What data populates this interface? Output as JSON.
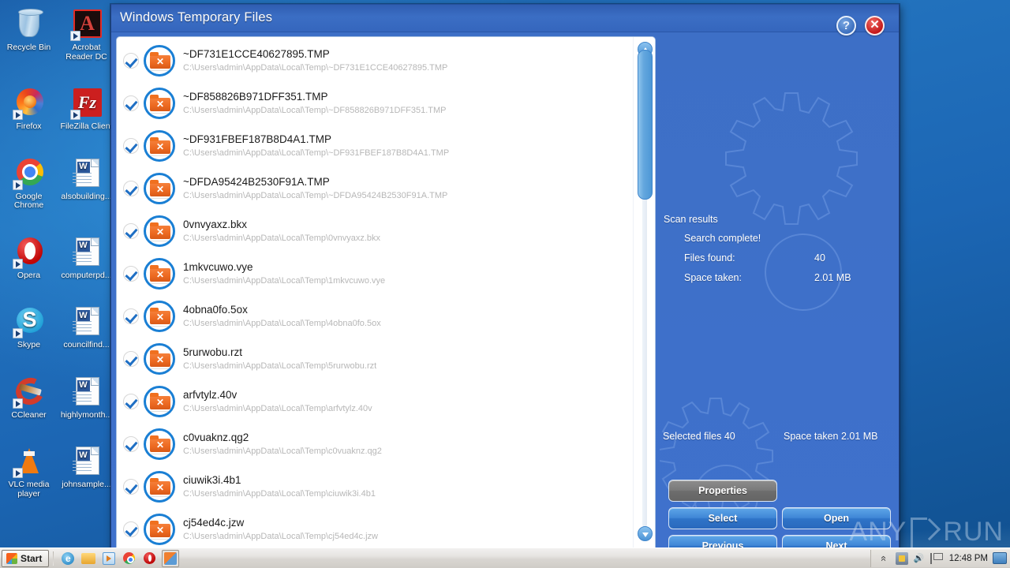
{
  "window": {
    "title": "Windows Temporary Files",
    "help_label": "?",
    "close_label": "✕"
  },
  "files": [
    {
      "name": "~DF731E1CCE40627895.TMP",
      "path": "C:\\Users\\admin\\AppData\\Local\\Temp\\~DF731E1CCE40627895.TMP",
      "checked": true
    },
    {
      "name": "~DF858826B971DFF351.TMP",
      "path": "C:\\Users\\admin\\AppData\\Local\\Temp\\~DF858826B971DFF351.TMP",
      "checked": true
    },
    {
      "name": "~DF931FBEF187B8D4A1.TMP",
      "path": "C:\\Users\\admin\\AppData\\Local\\Temp\\~DF931FBEF187B8D4A1.TMP",
      "checked": true
    },
    {
      "name": "~DFDA95424B2530F91A.TMP",
      "path": "C:\\Users\\admin\\AppData\\Local\\Temp\\~DFDA95424B2530F91A.TMP",
      "checked": true
    },
    {
      "name": "0vnvyaxz.bkx",
      "path": "C:\\Users\\admin\\AppData\\Local\\Temp\\0vnvyaxz.bkx",
      "checked": true
    },
    {
      "name": "1mkvcuwo.vye",
      "path": "C:\\Users\\admin\\AppData\\Local\\Temp\\1mkvcuwo.vye",
      "checked": true
    },
    {
      "name": "4obna0fo.5ox",
      "path": "C:\\Users\\admin\\AppData\\Local\\Temp\\4obna0fo.5ox",
      "checked": true
    },
    {
      "name": "5rurwobu.rzt",
      "path": "C:\\Users\\admin\\AppData\\Local\\Temp\\5rurwobu.rzt",
      "checked": true
    },
    {
      "name": "arfvtylz.40v",
      "path": "C:\\Users\\admin\\AppData\\Local\\Temp\\arfvtylz.40v",
      "checked": true
    },
    {
      "name": "c0vuaknz.qg2",
      "path": "C:\\Users\\admin\\AppData\\Local\\Temp\\c0vuaknz.qg2",
      "checked": true
    },
    {
      "name": "ciuwik3i.4b1",
      "path": "C:\\Users\\admin\\AppData\\Local\\Temp\\ciuwik3i.4b1",
      "checked": true
    },
    {
      "name": "cj54ed4c.jzw",
      "path": "C:\\Users\\admin\\AppData\\Local\\Temp\\cj54ed4c.jzw",
      "checked": true
    }
  ],
  "results": {
    "title": "Scan results",
    "status": "Search complete!",
    "files_found_label": "Files found:",
    "files_found_value": "40",
    "space_taken_label": "Space taken:",
    "space_taken_value": "2.01 MB"
  },
  "summary": {
    "selected_files": "Selected files  40",
    "space_taken": "Space taken 2.01 MB"
  },
  "buttons": {
    "properties": "Properties",
    "select": "Select",
    "open": "Open",
    "previous": "Previous",
    "next": "Next"
  },
  "desktop_icons": [
    {
      "label": "Recycle Bin",
      "art": "art-recycle",
      "shortcut": false,
      "icon": "recycle-bin-icon"
    },
    {
      "label": "Acrobat Reader DC",
      "art": "art-acrobat",
      "shortcut": true,
      "icon": "acrobat-reader-icon"
    },
    {
      "label": "Firefox",
      "art": "art-firefox",
      "shortcut": true,
      "icon": "firefox-icon"
    },
    {
      "label": "FileZilla Client",
      "art": "art-filezilla",
      "shortcut": true,
      "icon": "filezilla-icon"
    },
    {
      "label": "Google Chrome",
      "art": "art-chrome",
      "shortcut": true,
      "icon": "chrome-icon"
    },
    {
      "label": "alsobuilding...",
      "art": "art-word",
      "shortcut": false,
      "icon": "word-document-icon"
    },
    {
      "label": "Opera",
      "art": "art-opera",
      "shortcut": true,
      "icon": "opera-icon"
    },
    {
      "label": "computerpd...",
      "art": "art-word",
      "shortcut": false,
      "icon": "word-document-icon"
    },
    {
      "label": "Skype",
      "art": "art-skype",
      "shortcut": true,
      "icon": "skype-icon"
    },
    {
      "label": "councilfind...",
      "art": "art-word",
      "shortcut": false,
      "icon": "word-document-icon"
    },
    {
      "label": "CCleaner",
      "art": "art-ccleaner",
      "shortcut": true,
      "icon": "ccleaner-icon"
    },
    {
      "label": "highlymonth...",
      "art": "art-word",
      "shortcut": false,
      "icon": "word-document-icon"
    },
    {
      "label": "VLC media player",
      "art": "art-vlc",
      "shortcut": true,
      "icon": "vlc-icon"
    },
    {
      "label": "johnsample...",
      "art": "art-word",
      "shortcut": false,
      "icon": "word-document-icon"
    }
  ],
  "taskbar": {
    "start_label": "Start",
    "clock": "12:48 PM"
  },
  "watermark": {
    "left_text": "ANY",
    "right_text": "RUN"
  },
  "colors": {
    "window_blue": "#3f71cc",
    "title_blue": "#3566bd",
    "accent_orange": "#ed6a22",
    "check_blue": "#1f6fc4",
    "button_blue": "#3f86d6",
    "button_grey": "#7a7a7a"
  }
}
